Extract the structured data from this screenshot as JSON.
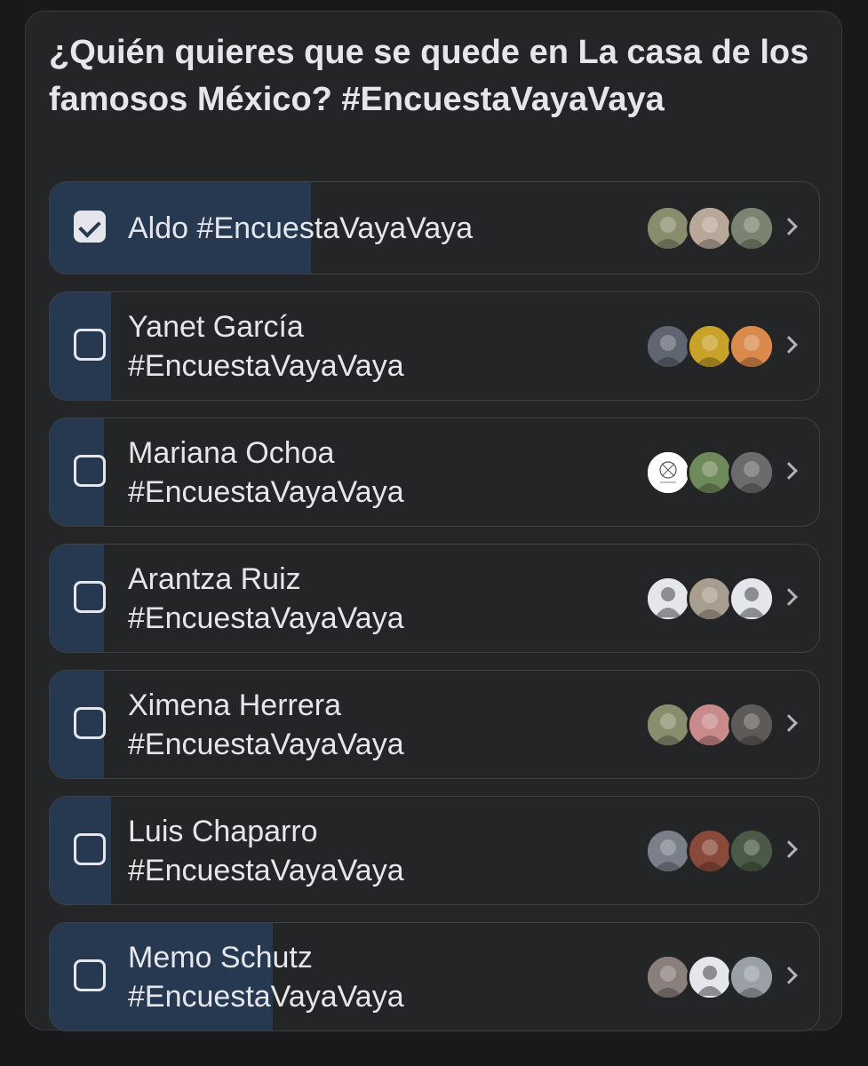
{
  "poll": {
    "question": "¿Quién quieres que se quede en La casa de los famosos México? #EncuestaVayaVaya",
    "options": [
      {
        "name": "Aldo",
        "tag": "#EncuestaVayaVaya",
        "selected": true,
        "vote_share": 0.34,
        "avatars": [
          {
            "icon": "photo-avatar",
            "color": "#8a8c6e"
          },
          {
            "icon": "photo-avatar",
            "color": "#b9a79a"
          },
          {
            "icon": "photo-avatar",
            "color": "#7a8470"
          }
        ]
      },
      {
        "name": "Yanet García",
        "tag": "#EncuestaVayaVaya",
        "selected": false,
        "vote_share": 0.08,
        "avatars": [
          {
            "icon": "photo-avatar",
            "color": "#5f6672"
          },
          {
            "icon": "photo-avatar",
            "color": "#c9a22a"
          },
          {
            "icon": "photo-avatar",
            "color": "#d98a4c"
          }
        ]
      },
      {
        "name": "Mariana Ochoa",
        "tag": "#EncuestaVayaVaya",
        "selected": false,
        "vote_share": 0.07,
        "avatars": [
          {
            "icon": "logo-avatar",
            "color": "#ffffff"
          },
          {
            "icon": "photo-avatar",
            "color": "#6f8a5a"
          },
          {
            "icon": "photo-avatar",
            "color": "#6b6b6b"
          }
        ]
      },
      {
        "name": "Arantza Ruiz",
        "tag": "#EncuestaVayaVaya",
        "selected": false,
        "vote_share": 0.07,
        "avatars": [
          {
            "icon": "default-user-avatar",
            "color": "#b0b3b8"
          },
          {
            "icon": "photo-avatar",
            "color": "#a89d8f"
          },
          {
            "icon": "default-user-avatar",
            "color": "#b0b3b8"
          }
        ]
      },
      {
        "name": "Ximena Herrera",
        "tag": "#EncuestaVayaVaya",
        "selected": false,
        "vote_share": 0.07,
        "avatars": [
          {
            "icon": "photo-avatar",
            "color": "#8a8c6e"
          },
          {
            "icon": "photo-avatar",
            "color": "#c98a8a"
          },
          {
            "icon": "photo-avatar",
            "color": "#5e5a58"
          }
        ]
      },
      {
        "name": "Luis Chaparro",
        "tag": "#EncuestaVayaVaya",
        "selected": false,
        "vote_share": 0.08,
        "avatars": [
          {
            "icon": "photo-avatar",
            "color": "#7a7f8a"
          },
          {
            "icon": "photo-avatar",
            "color": "#8a4a3a"
          },
          {
            "icon": "photo-avatar",
            "color": "#4a5a46"
          }
        ]
      },
      {
        "name": "Memo Schutz",
        "tag": "#EncuestaVayaVaya",
        "selected": false,
        "vote_share": 0.29,
        "avatars": [
          {
            "icon": "photo-avatar",
            "color": "#8a7f7a"
          },
          {
            "icon": "default-user-avatar",
            "color": "#b0b3b8"
          },
          {
            "icon": "photo-avatar",
            "color": "#9aa0a8"
          }
        ]
      }
    ]
  },
  "colors": {
    "background": "#18191a",
    "card": "#242526",
    "vote_fill": "#263951",
    "text": "#e4e6eb",
    "muted": "#b0b3b8"
  }
}
